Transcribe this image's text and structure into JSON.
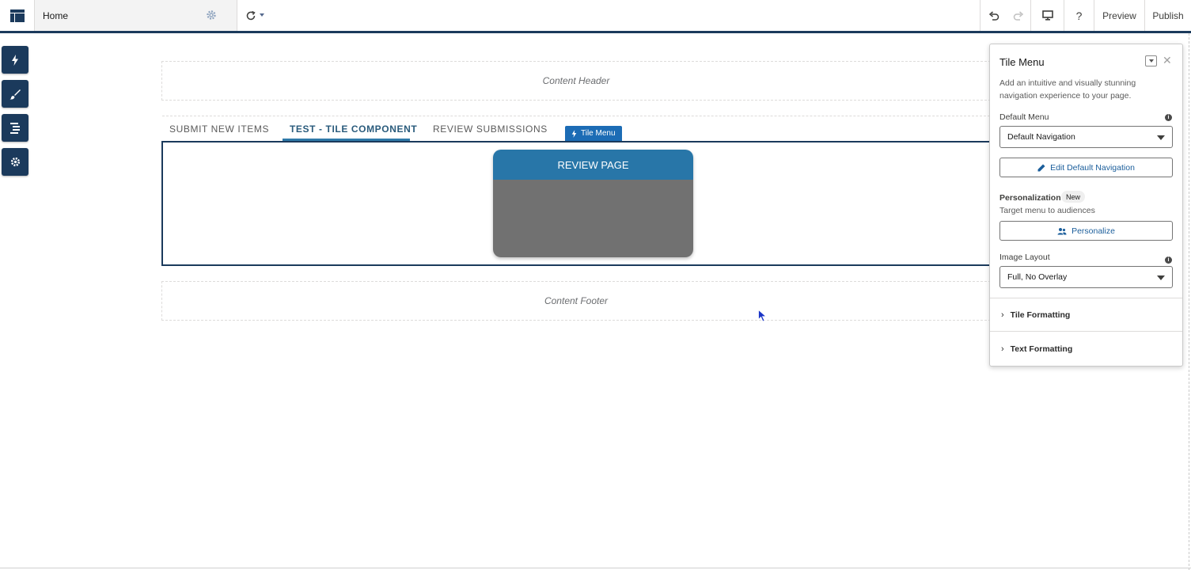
{
  "topbar": {
    "page_name": "Home",
    "preview_label": "Preview",
    "publish_label": "Publish",
    "icons": [
      "builder-logo-icon",
      "gear-icon",
      "chevron-down-icon",
      "refresh-icon",
      "undo-icon",
      "redo-icon",
      "desktop-icon",
      "help-icon"
    ]
  },
  "left_toolbar": {
    "icons": [
      "lightning-icon",
      "brush-icon",
      "list-icon",
      "gear-icon"
    ]
  },
  "canvas": {
    "content_header": "Content Header",
    "content_footer": "Content Footer",
    "tabs": [
      {
        "label": "SUBMIT NEW ITEMS"
      },
      {
        "label": "TEST - TILE COMPONENT",
        "active": true
      },
      {
        "label": "REVIEW SUBMISSIONS"
      }
    ],
    "component_label": "Tile Menu",
    "tile_title": "REVIEW PAGE"
  },
  "panel": {
    "title": "Tile Menu",
    "description": "Add an intuitive and visually stunning navigation experience to your page.",
    "default_menu_label": "Default Menu",
    "default_menu_value": "Default Navigation",
    "edit_button": "Edit Default Navigation",
    "personalization_label": "Personalization",
    "new_badge": "New",
    "personalization_desc": "Target menu to audiences",
    "personalize_button": "Personalize",
    "image_layout_label": "Image Layout",
    "image_layout_value": "Full, No Overlay",
    "sections": [
      "Tile Formatting",
      "Text Formatting"
    ]
  },
  "colors": {
    "primary_dark": "#1b3a5c",
    "accent_blue": "#2876a8",
    "tile_body": "#717171"
  }
}
